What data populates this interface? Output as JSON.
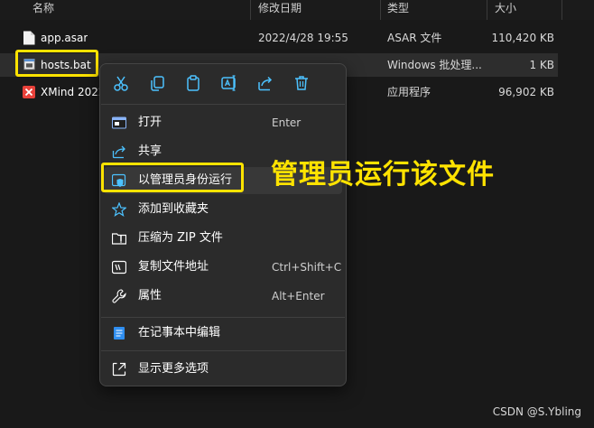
{
  "columns": {
    "name": "名称",
    "date": "修改日期",
    "type": "类型",
    "size": "大小"
  },
  "files": [
    {
      "name": "app.asar",
      "date": "2022/4/28 19:55",
      "type": "ASAR 文件",
      "size": "110,420 KB",
      "icon": "file-icon"
    },
    {
      "name": "hosts.bat",
      "date": "",
      "type": "Windows 批处理...",
      "size": "1 KB",
      "icon": "batch-file-icon",
      "selected": true
    },
    {
      "name": "XMind 2022",
      "date": "",
      "type": "应用程序",
      "size": "96,902 KB",
      "icon": "xmind-app-icon"
    }
  ],
  "context_menu": {
    "toolbar": [
      "cut-icon",
      "copy-icon",
      "paste-icon",
      "rename-icon",
      "share-icon",
      "delete-icon"
    ],
    "items": [
      {
        "label": "打开",
        "shortcut": "Enter",
        "icon": "open-icon"
      },
      {
        "label": "共享",
        "shortcut": "",
        "icon": "share-icon"
      },
      {
        "label": "以管理员身份运行",
        "shortcut": "",
        "icon": "shield-icon"
      },
      {
        "label": "添加到收藏夹",
        "shortcut": "",
        "icon": "star-icon"
      },
      {
        "label": "压缩为 ZIP 文件",
        "shortcut": "",
        "icon": "zip-folder-icon"
      },
      {
        "label": "复制文件地址",
        "shortcut": "Ctrl+Shift+C",
        "icon": "copy-path-icon"
      },
      {
        "label": "属性",
        "shortcut": "Alt+Enter",
        "icon": "wrench-icon"
      },
      {
        "label": "在记事本中编辑",
        "shortcut": "",
        "icon": "notepad-icon"
      },
      {
        "label": "显示更多选项",
        "shortcut": "",
        "icon": "more-options-icon"
      }
    ]
  },
  "annotation": "管理员运行该文件",
  "watermark": "CSDN @S.Ybling",
  "colors": {
    "highlight": "#ffe300",
    "menu_bg": "#2b2b2b",
    "background": "#191919",
    "accent": "#4cc2ff"
  }
}
